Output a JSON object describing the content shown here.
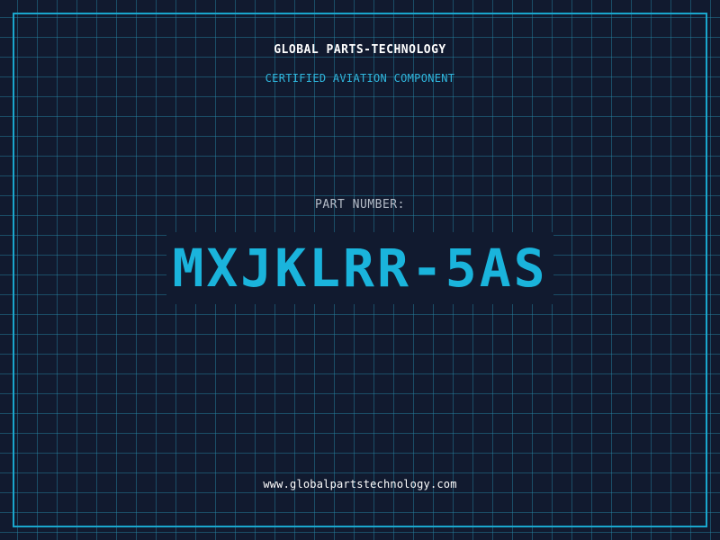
{
  "header": {
    "company": "GLOBAL PARTS-TECHNOLOGY",
    "subtitle": "CERTIFIED AVIATION COMPONENT"
  },
  "main": {
    "part_label": "PART NUMBER:",
    "part_number": "MXJKLRR-5AS"
  },
  "footer": {
    "url": "www.globalpartstechnology.com"
  },
  "colors": {
    "background": "#111a2f",
    "accent": "#1ab4dc",
    "border": "#1aa6cc"
  }
}
